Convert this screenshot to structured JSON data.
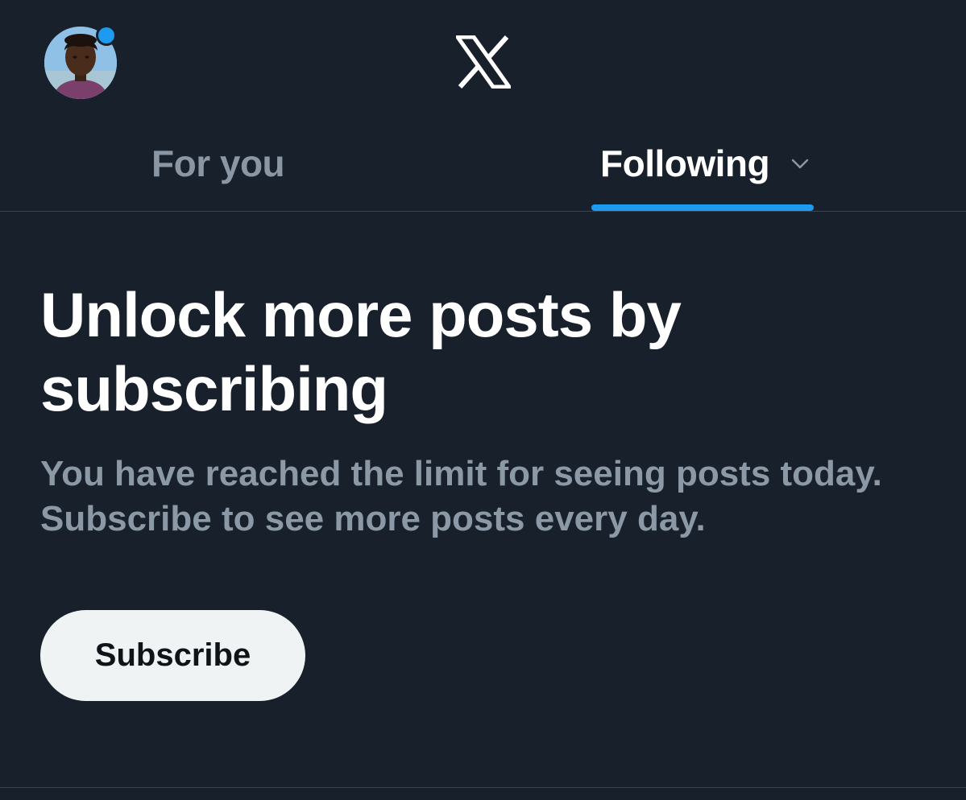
{
  "header": {
    "logo_icon": "x-logo-icon",
    "avatar_icon": "profile-avatar",
    "notification_dot_color": "#1d9bf0"
  },
  "tabs": [
    {
      "label": "For you",
      "active": false
    },
    {
      "label": "Following",
      "active": true,
      "icon": "chevron-down-icon"
    }
  ],
  "colors": {
    "background": "#18202b",
    "accent": "#1d9bf0",
    "muted_text": "#8b98a5",
    "button_bg": "#eff3f4"
  },
  "paywall": {
    "title": "Unlock more posts by subscribing",
    "message": "You have reached the limit for seeing posts today. Subscribe to see more posts every day.",
    "button_label": "Subscribe"
  }
}
